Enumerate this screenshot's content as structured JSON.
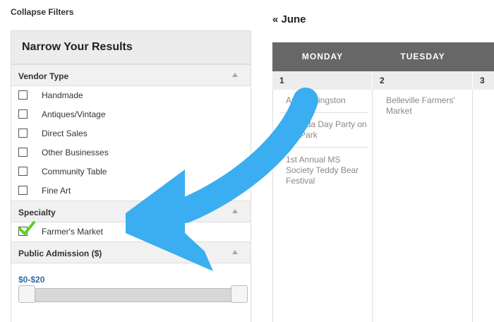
{
  "collapse_filters": "Collapse Filters",
  "filters": {
    "title": "Narrow Your Results",
    "vendor_type": {
      "title": "Vendor Type",
      "options": [
        "Handmade",
        "Antiques/Vintage",
        "Direct Sales",
        "Other Businesses",
        "Community Table",
        "Fine Art"
      ]
    },
    "specialty": {
      "title": "Specialty",
      "options": [
        "Farmer's Market"
      ]
    },
    "admission": {
      "title": "Public Admission ($)",
      "range_label": "$0-$20"
    }
  },
  "calendar": {
    "nav_label": "« June",
    "days": [
      "MONDAY",
      "TUESDAY"
    ],
    "dates": [
      "1",
      "2",
      "3"
    ],
    "monday_events": [
      "Artfest Kingston",
      "Canada Day Party on the Park",
      "1st Annual MS Society Teddy Bear Festival"
    ],
    "tuesday_events": [
      "Belleville Farmers' Market"
    ]
  },
  "colors": {
    "arrow": "#3aaef0",
    "check": "#5fd11f",
    "calendar_header": "#676767",
    "range_label": "#2a6fa8"
  }
}
